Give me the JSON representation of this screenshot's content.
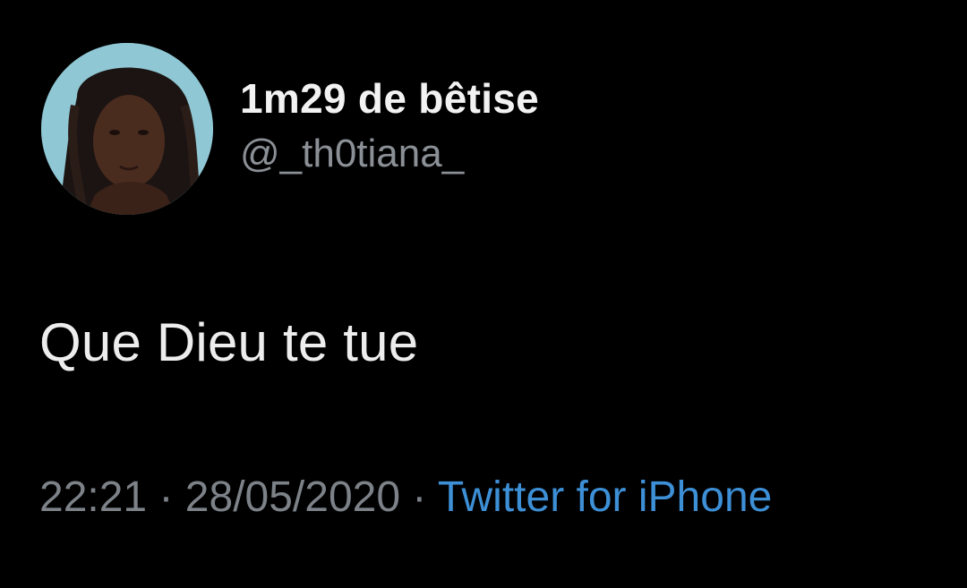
{
  "tweet": {
    "author": {
      "display_name": "1m29 de bêtise",
      "handle": "@_th0tiana_",
      "avatar": "profile-photo"
    },
    "text": "Que Dieu te tue",
    "meta": {
      "time": "22:21",
      "separator": "·",
      "date": "28/05/2020",
      "client": "Twitter for iPhone"
    }
  },
  "colors": {
    "background": "#000000",
    "name": "#f2f2f2",
    "handle": "#8b9096",
    "text": "#ededed",
    "meta": "#7c8288",
    "link": "#3d8fd6"
  }
}
